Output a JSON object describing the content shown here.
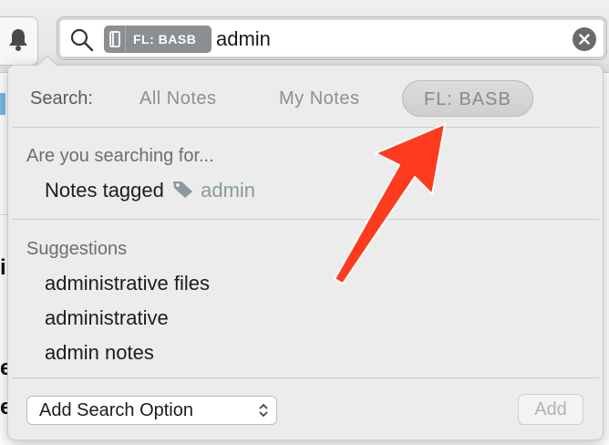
{
  "search": {
    "scope_chip": "FL: BASB",
    "query": "admin"
  },
  "popover": {
    "scope_label": "Search:",
    "scopes": [
      {
        "label": "All Notes",
        "selected": false
      },
      {
        "label": "My Notes",
        "selected": false
      },
      {
        "label": "FL: BASB",
        "selected": true
      }
    ],
    "searching_for_title": "Are you searching for...",
    "tagged_prefix": "Notes tagged",
    "tagged_value": "admin",
    "suggestions_title": "Suggestions",
    "suggestions": [
      "administrative files",
      "administrative",
      "admin notes"
    ],
    "add_option_select": "Add Search Option",
    "add_button": "Add"
  },
  "background_fragments": [
    "i",
    "e",
    "e"
  ],
  "colors": {
    "annotation_arrow": "#ff3b1f",
    "chip": "#8a8f91",
    "popover_bg": "#ececec"
  }
}
